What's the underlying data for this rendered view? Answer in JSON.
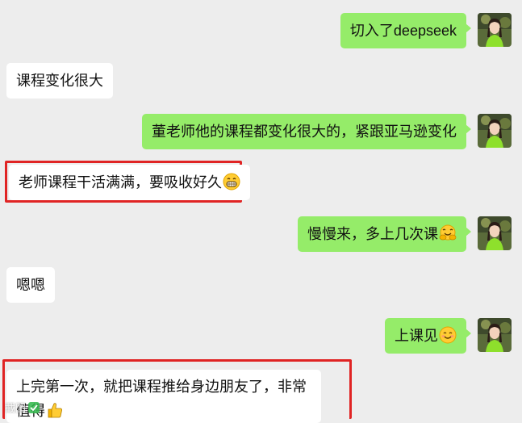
{
  "messages": [
    {
      "side": "right",
      "text": "切入了deepseek"
    },
    {
      "side": "left",
      "text": "课程变化很大"
    },
    {
      "side": "right",
      "text": "董老师他的课程都变化很大的，紧跟亚马逊变化"
    },
    {
      "side": "left",
      "text": "老师课程干活满满，要吸收好久",
      "emoji": "grin-emoji",
      "highlighted": true
    },
    {
      "side": "right",
      "text": "慢慢来，多上几次课",
      "emoji": "hugging-emoji"
    },
    {
      "side": "left",
      "text": "嗯嗯"
    },
    {
      "side": "right",
      "text": "上课见",
      "emoji": "smile-emoji"
    },
    {
      "side": "left",
      "text": "上完第一次，就把课程推给身边朋友了，非常值得",
      "emoji": "thumbs-up-emoji",
      "highlighted": true
    }
  ],
  "watermark": "截图",
  "colors": {
    "chat_background": "#ededed",
    "incoming_bubble": "#ffffff",
    "outgoing_bubble": "#95ec69",
    "highlight_border": "#e02424"
  }
}
